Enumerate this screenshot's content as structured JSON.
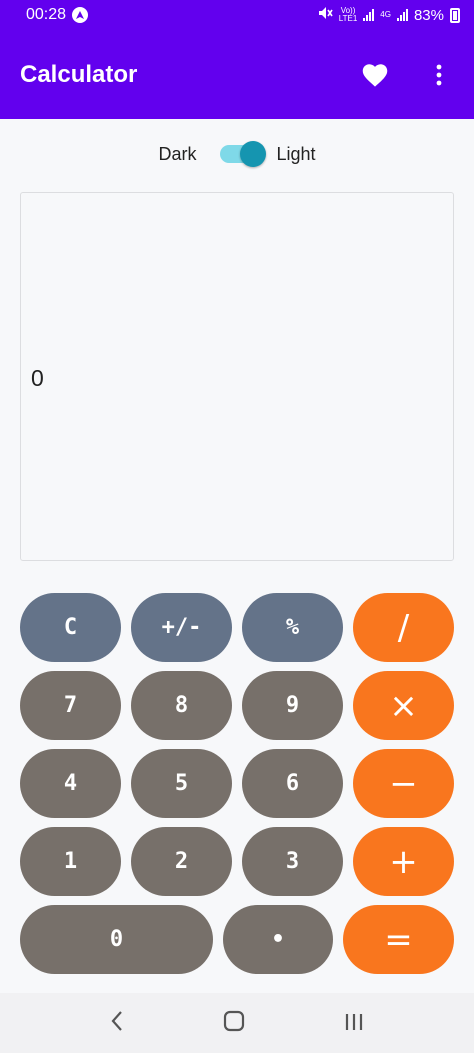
{
  "status_bar": {
    "time": "00:28",
    "network_small_top": "Vo))",
    "network_small_bottom": "LTE1",
    "network_4g": "4G",
    "battery": "83%"
  },
  "app_bar": {
    "title": "Calculator"
  },
  "theme": {
    "dark_label": "Dark",
    "light_label": "Light",
    "toggle_state": "light"
  },
  "display": {
    "value": "0"
  },
  "keypad": {
    "row1": [
      "C",
      "+/-",
      "%",
      "/"
    ],
    "row2": [
      "7",
      "8",
      "9",
      "×"
    ],
    "row3": [
      "4",
      "5",
      "6",
      "−"
    ],
    "row4": [
      "1",
      "2",
      "3",
      "+"
    ],
    "row5": [
      "0",
      "•",
      "="
    ]
  },
  "nav": {
    "back": "‹",
    "home": "○",
    "recents": "|||"
  },
  "colors": {
    "primary": "#6200ee",
    "function_key": "#647389",
    "number_key": "#77706a",
    "operator_key": "#f9761e",
    "toggle_knob": "#1595b0"
  }
}
